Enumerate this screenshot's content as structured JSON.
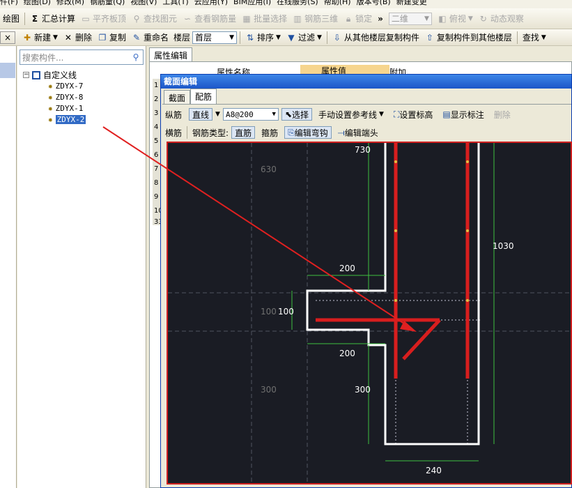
{
  "menubar": {
    "items": [
      "件(F)",
      "绘图(D)",
      "修改(M)",
      "钢筋量(Q)",
      "视图(V)",
      "工具(T)",
      "云应用(Y)",
      "BIM应用(I)",
      "在线服务(S)",
      "帮助(H)",
      "版本号(B)",
      "新建变更"
    ]
  },
  "toolbar1": {
    "items": [
      {
        "label": "绘图",
        "enabled": true,
        "icon": "draw-icon"
      },
      {
        "label": "汇总计算",
        "enabled": true,
        "icon": "sigma-icon"
      },
      {
        "label": "平齐板顶",
        "enabled": false,
        "icon": "flat-top-icon"
      },
      {
        "label": "查找图元",
        "enabled": false,
        "icon": "find-element-icon"
      },
      {
        "label": "查看钢筋量",
        "enabled": false,
        "icon": "view-rebar-icon"
      },
      {
        "label": "批量选择",
        "enabled": false,
        "icon": "batch-select-icon"
      },
      {
        "label": "钢筋三维",
        "enabled": false,
        "icon": "rebar-3d-icon"
      },
      {
        "label": "锁定",
        "enabled": false,
        "icon": "lock-icon"
      }
    ],
    "more": "»",
    "view_combo": "二维",
    "view_mode": "俯视",
    "dynamic": "动态观察"
  },
  "toolbar2": {
    "close": "×",
    "new": "新建",
    "delete": "删除",
    "copy": "复制",
    "rename": "重命名",
    "floor_label": "楼层",
    "floor_value": "首层",
    "sort": "排序",
    "filter": "过滤",
    "copy_from": "从其他楼层复制构件",
    "copy_to": "复制构件到其他楼层",
    "find": "查找"
  },
  "tree": {
    "search_placeholder": "搜索构件...",
    "root": "自定义线",
    "items": [
      "ZDYX-7",
      "ZDYX-8",
      "ZDYX-1",
      "ZDYX-2"
    ],
    "selected_index": 3
  },
  "props": {
    "tab": "属性编辑",
    "col_name": "属性名称",
    "col_value": "属性值",
    "col_extra": "附加",
    "row_numbers": [
      "1",
      "2",
      "3",
      "4",
      "5",
      "6",
      "7",
      "8",
      "9",
      "10",
      "33"
    ]
  },
  "dialog": {
    "title": "截面编辑",
    "tabs": [
      "截面",
      "配筋"
    ],
    "active_tab": 1,
    "row1": {
      "longitudinal": "纵筋",
      "line_type": "直线",
      "rebar_spec": "A8@200",
      "select": "选择",
      "manual_ref": "手动设置参考线",
      "set_elevation": "设置标高",
      "show_labels": "显示标注",
      "delete": "删除"
    },
    "row2": {
      "transverse": "横筋",
      "rebar_type_label": "钢筋类型:",
      "straight": "直筋",
      "stirrup": "箍筋",
      "edit_hook": "编辑弯钩",
      "edit_end": "编辑端头"
    }
  },
  "drawing": {
    "dims": {
      "top": "730",
      "top_grey": "630",
      "right": "1030",
      "upper_width": "200",
      "height_left": "100",
      "height_left_grey": "100",
      "lower_width": "200",
      "lower_height": "300",
      "lower_height_grey": "300",
      "bottom_width": "240"
    },
    "colors": {
      "background": "#1a1c24",
      "outline": "#ffffff",
      "rebar": "#d81e1e",
      "dimension": "#3fbf3f",
      "annotation_arrow": "#e02020"
    }
  }
}
